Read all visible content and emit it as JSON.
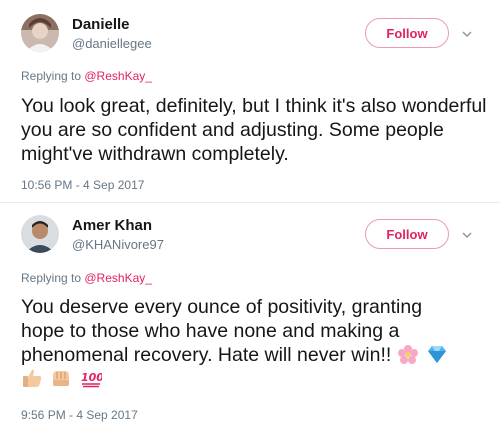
{
  "tweets": [
    {
      "name": "Danielle",
      "handle": "@daniellegee",
      "follow_label": "Follow",
      "reply_prefix": "Replying to ",
      "reply_to": "@ReshKay_",
      "text": "You look great, definitely, but I think it's also wonderful you are so confident and adjusting. Some people might've withdrawn completely.",
      "timestamp": "10:56 PM - 4 Sep 2017"
    },
    {
      "name": "Amer Khan",
      "handle": "@KHANivore97",
      "follow_label": "Follow",
      "reply_prefix": "Replying to ",
      "reply_to": "@ReshKay_",
      "text": "You deserve every ounce of positivity, granting hope to those who have none and making a phenomenal recovery. Hate will never win!!",
      "emojis": [
        "cherry-blossom",
        "gem",
        "thumbs-up",
        "fist",
        "hundred-points"
      ],
      "timestamp": "9:56 PM - 4 Sep 2017"
    }
  ],
  "colors": {
    "accent": "#e0245e",
    "follow_border": "#ec9bb0",
    "secondary_text": "#657786"
  }
}
